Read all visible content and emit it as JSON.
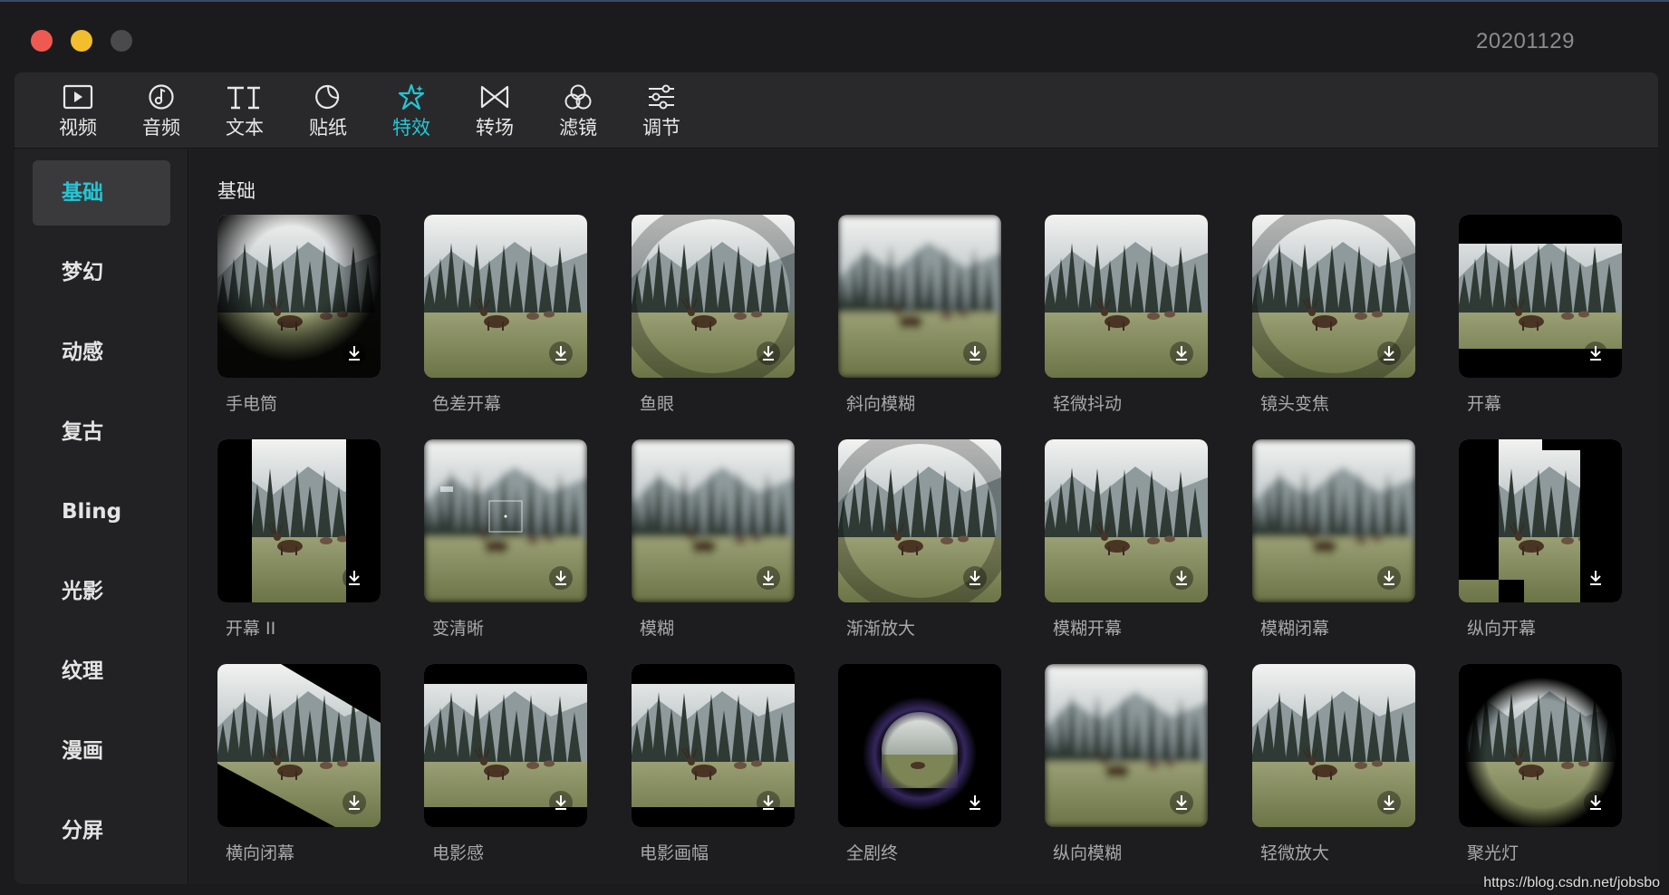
{
  "window": {
    "build_label": "20201129"
  },
  "toolbar": {
    "tabs": [
      {
        "label": "视频",
        "icon": "video-icon"
      },
      {
        "label": "音频",
        "icon": "music-note-icon"
      },
      {
        "label": "文本",
        "icon": "text-icon"
      },
      {
        "label": "贴纸",
        "icon": "sticker-icon"
      },
      {
        "label": "特效",
        "icon": "sparkle-star-icon",
        "active": true
      },
      {
        "label": "转场",
        "icon": "transition-bowtie-icon"
      },
      {
        "label": "滤镜",
        "icon": "filter-circles-icon"
      },
      {
        "label": "调节",
        "icon": "sliders-icon"
      }
    ]
  },
  "sidebar": {
    "items": [
      {
        "label": "基础",
        "active": true
      },
      {
        "label": "梦幻"
      },
      {
        "label": "动感"
      },
      {
        "label": "复古"
      },
      {
        "label": "Bling"
      },
      {
        "label": "光影"
      },
      {
        "label": "纹理"
      },
      {
        "label": "漫画"
      },
      {
        "label": "分屏"
      }
    ]
  },
  "content": {
    "section_title": "基础",
    "effects": [
      {
        "name": "手电筒",
        "style": "flashlight"
      },
      {
        "name": "色差开幕",
        "style": "normal"
      },
      {
        "name": "鱼眼",
        "style": "fisheye"
      },
      {
        "name": "斜向模糊",
        "style": "blur"
      },
      {
        "name": "轻微抖动",
        "style": "normal"
      },
      {
        "name": "镜头变焦",
        "style": "fisheye"
      },
      {
        "name": "开幕",
        "style": "letterbox"
      },
      {
        "name": "开幕 II",
        "style": "vertical-open"
      },
      {
        "name": "变清晰",
        "style": "focus"
      },
      {
        "name": "模糊",
        "style": "blur"
      },
      {
        "name": "渐渐放大",
        "style": "fisheye"
      },
      {
        "name": "模糊开幕",
        "style": "normal"
      },
      {
        "name": "模糊闭幕",
        "style": "blur"
      },
      {
        "name": "纵向开幕",
        "style": "stair"
      },
      {
        "name": "横向闭幕",
        "style": "diagonal"
      },
      {
        "name": "电影感",
        "style": "cinema"
      },
      {
        "name": "电影画幅",
        "style": "cinema"
      },
      {
        "name": "全剧终",
        "style": "iris"
      },
      {
        "name": "纵向模糊",
        "style": "blur"
      },
      {
        "name": "轻微放大",
        "style": "normal"
      },
      {
        "name": "聚光灯",
        "style": "spotlight"
      }
    ]
  },
  "watermark": "https://blog.csdn.net/jobsbo",
  "colors": {
    "accent": "#23c6d6",
    "background": "#1d1d1f",
    "toolbar": "#29292b"
  }
}
